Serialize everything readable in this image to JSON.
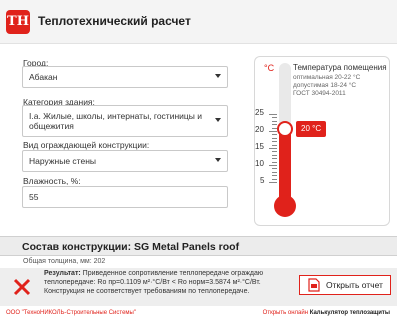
{
  "app": {
    "title": "Теплотехнический расчет",
    "logo_text": "ТН"
  },
  "form": {
    "city": {
      "label": "Город:",
      "value": "Абакан"
    },
    "category": {
      "label": "Категория здания:",
      "value": "I.a. Жилые, школы, интернаты, гостиницы и общежития"
    },
    "construction": {
      "label": "Вид ограждающей конструкции:",
      "value": "Наружные стены"
    },
    "humidity": {
      "label": "Влажность, %:",
      "value": "55"
    }
  },
  "thermometer": {
    "unit": "°C",
    "title": "Температура помещения",
    "optimal": "оптимальная 20-22 °C",
    "allowed": "допустимая 18-24 °C",
    "standard": "ГОСТ 30494-2011",
    "ticks": [
      "25",
      "20",
      "15",
      "10",
      "5"
    ],
    "value_label": "20 °C",
    "value": 20
  },
  "composition": {
    "title": "Состав конструкции: SG Metal Panels roof",
    "thickness": "Общая толщина, мм: 202"
  },
  "result": {
    "label": "Результат:",
    "line1": "Приведенное сопротивление теплопередаче ограждаю",
    "line2": "теплопередаче: Ro пр=0.1109 м²·°С/Вт < Ro норм=3.5874 м²·°С/Вт.",
    "line3": "Конструкция не соответствует требованиям по теплопередаче.",
    "button": "Открыть отчет"
  },
  "footer": {
    "company": "ООО \"ТехноНИКОЛЬ-Строительные Системы\"",
    "online_prefix": "Открыть онлайн",
    "online_link": "Калькулятор теплозащиты"
  },
  "colors": {
    "accent": "#e0221b"
  }
}
